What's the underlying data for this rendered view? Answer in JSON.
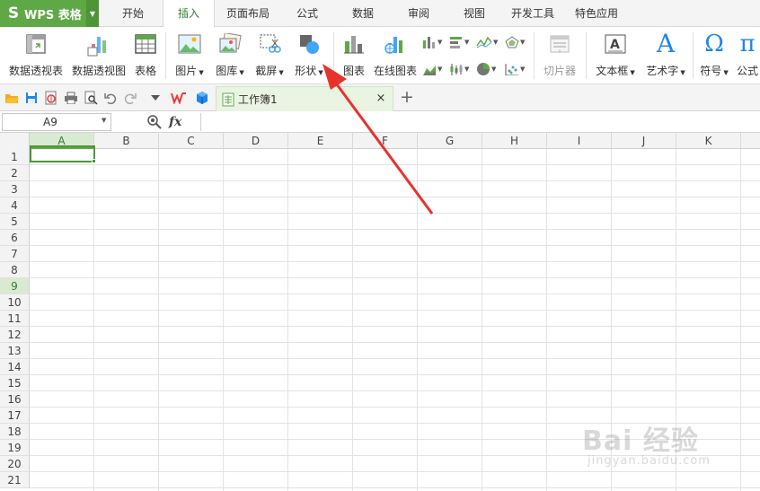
{
  "app": {
    "title": "WPS 表格",
    "logo_letter": "S"
  },
  "menu": {
    "tabs": [
      {
        "label": "开始"
      },
      {
        "label": "插入",
        "active": true
      },
      {
        "label": "页面布局"
      },
      {
        "label": "公式"
      },
      {
        "label": "数据"
      },
      {
        "label": "审阅"
      },
      {
        "label": "视图"
      },
      {
        "label": "开发工具"
      },
      {
        "label": "特色应用"
      }
    ]
  },
  "ribbon": {
    "pivot_table": "数据透视表",
    "pivot_chart": "数据透视图",
    "table": "表格",
    "picture": "图片",
    "gallery": "图库",
    "screenshot": "截屏",
    "shapes": "形状",
    "chart": "图表",
    "online_chart": "在线图表",
    "slicer": "切片器",
    "textbox": "文本框",
    "wordart": "艺术字",
    "symbol": "符号",
    "formula": "公式",
    "symbol_glyph": "Ω",
    "formula_glyph": "π",
    "wordart_glyph": "A"
  },
  "document": {
    "tab_name": "工作簿1",
    "close_glyph": "×",
    "new_tab_glyph": "+"
  },
  "formula_bar": {
    "name_box": "A9",
    "fx": "fx",
    "value": ""
  },
  "grid": {
    "columns": [
      "A",
      "B",
      "C",
      "D",
      "E",
      "F",
      "G",
      "H",
      "I",
      "J",
      "K"
    ],
    "rows": [
      "1",
      "2",
      "3",
      "4",
      "5",
      "6",
      "7",
      "8",
      "9",
      "10",
      "11",
      "12",
      "13",
      "14",
      "15",
      "16",
      "17",
      "18",
      "19",
      "20",
      "21"
    ],
    "selected_column": "A",
    "selected_row": "9"
  },
  "colors": {
    "brand": "#5fa846",
    "annotation": "#e8322c"
  },
  "watermark": {
    "brand": "Bai 经验",
    "url": "jingyan.baidu.com"
  }
}
